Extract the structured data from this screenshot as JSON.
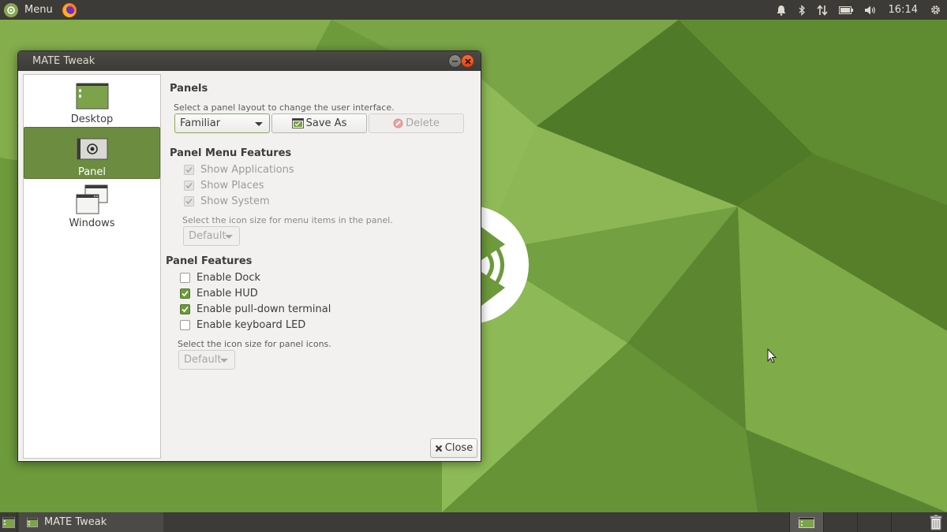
{
  "top_panel": {
    "menu_label": "Menu",
    "clock": "16:14",
    "tray_icons": [
      "bell-icon",
      "bluetooth-icon",
      "network-icon",
      "battery-icon",
      "volume-icon",
      "gear-icon"
    ]
  },
  "window": {
    "title": "MATE Tweak",
    "sidebar": {
      "items": [
        {
          "label": "Desktop",
          "icon": "desktop-icon",
          "selected": false
        },
        {
          "label": "Panel",
          "icon": "panel-icon",
          "selected": true
        },
        {
          "label": "Windows",
          "icon": "windows-icon",
          "selected": false
        }
      ]
    },
    "panels": {
      "title": "Panels",
      "hint": "Select a panel layout to change the user interface.",
      "layout_value": "Familiar",
      "save_as_label": "Save As",
      "delete_label": "Delete"
    },
    "panel_menu_features": {
      "title": "Panel Menu Features",
      "options": [
        {
          "label": "Show Applications",
          "checked": true,
          "enabled": false
        },
        {
          "label": "Show Places",
          "checked": true,
          "enabled": false
        },
        {
          "label": "Show System",
          "checked": true,
          "enabled": false
        }
      ],
      "icon_size_hint": "Select the icon size for menu items in the panel.",
      "icon_size_value": "Default"
    },
    "panel_features": {
      "title": "Panel Features",
      "options": [
        {
          "label": "Enable Dock",
          "checked": false,
          "enabled": true
        },
        {
          "label": "Enable HUD",
          "checked": true,
          "enabled": true
        },
        {
          "label": "Enable pull-down terminal",
          "checked": true,
          "enabled": true
        },
        {
          "label": "Enable keyboard LED",
          "checked": false,
          "enabled": true
        }
      ],
      "icon_size_hint": "Select the icon size for panel icons.",
      "icon_size_value": "Default"
    },
    "close_label": "Close"
  },
  "bottom_panel": {
    "task_label": "MATE Tweak",
    "workspaces": 4,
    "active_workspace": 1
  },
  "colors": {
    "panel_bg": "#3c3b37",
    "accent_green": "#6c8d3f",
    "close_orange": "#e0551f",
    "wallpaper_green": "#6c9a3a"
  }
}
